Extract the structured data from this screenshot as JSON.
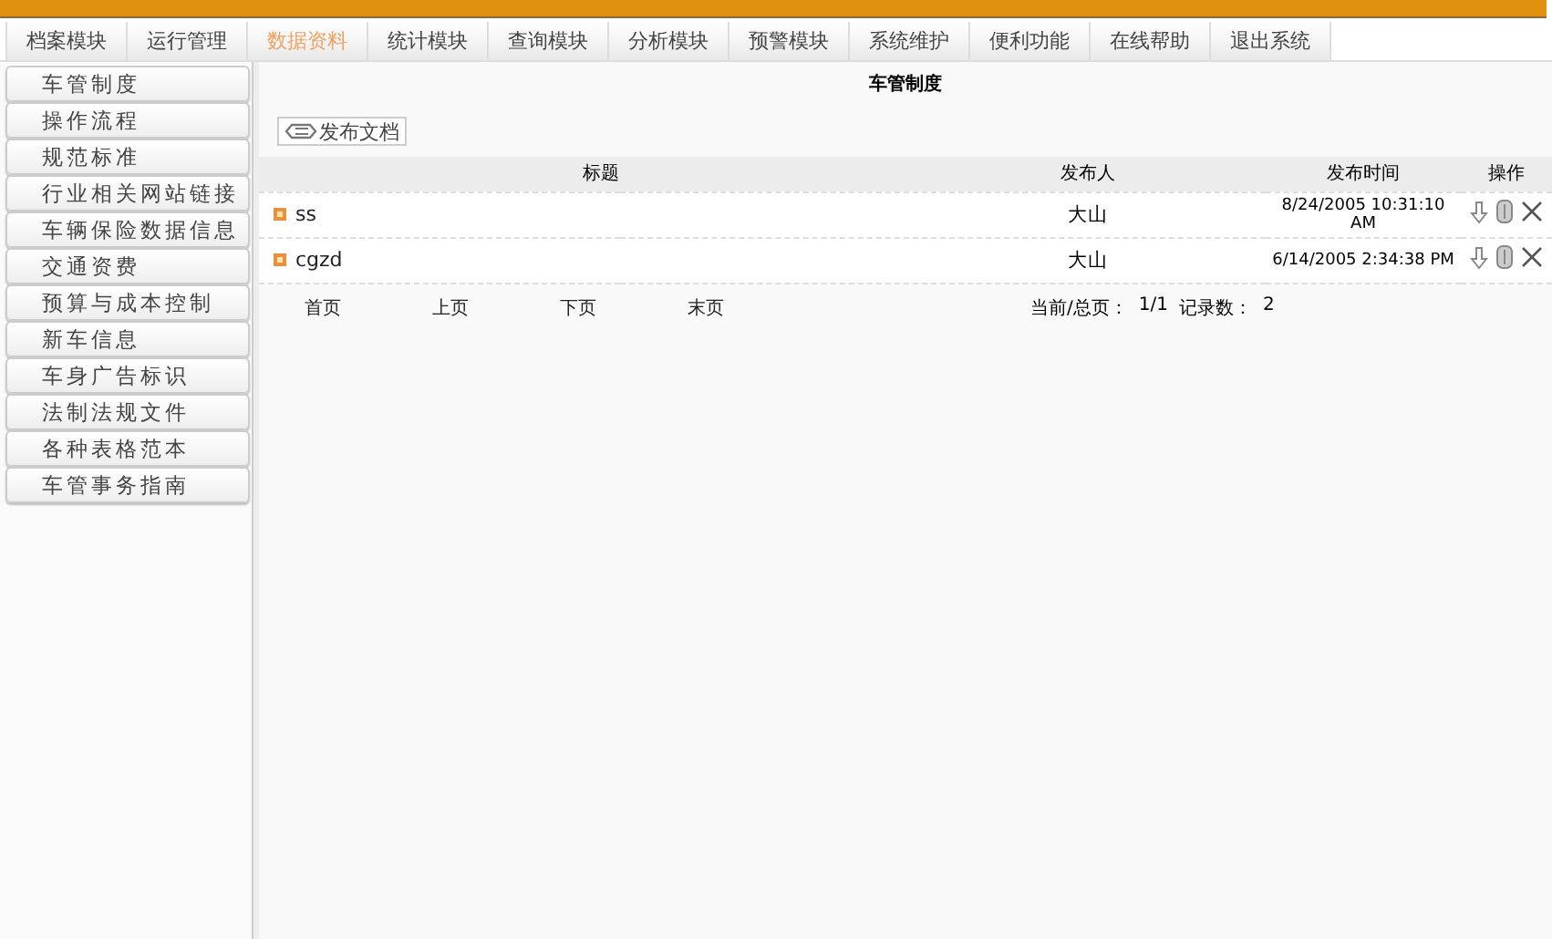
{
  "tabs": [
    {
      "label": "档案模块",
      "selected": false
    },
    {
      "label": "运行管理",
      "selected": false
    },
    {
      "label": "数据资料",
      "selected": true
    },
    {
      "label": "统计模块",
      "selected": false
    },
    {
      "label": "查询模块",
      "selected": false
    },
    {
      "label": "分析模块",
      "selected": false
    },
    {
      "label": "预警模块",
      "selected": false
    },
    {
      "label": "系统维护",
      "selected": false
    },
    {
      "label": "便利功能",
      "selected": false
    },
    {
      "label": "在线帮助",
      "selected": false
    },
    {
      "label": "退出系统",
      "selected": false
    }
  ],
  "sidebar": {
    "items": [
      "车管制度",
      "操作流程",
      "规范标准",
      "行业相关网站链接",
      "车辆保险数据信息",
      "交通资费",
      "预算与成本控制",
      "新车信息",
      "车身广告标识",
      "法制法规文件",
      "各种表格范本",
      "车管事务指南"
    ]
  },
  "content": {
    "title": "车管制度",
    "publish_button": "发布文档",
    "table": {
      "columns": [
        "标题",
        "发布人",
        "发布时间",
        "操作"
      ],
      "rows": [
        {
          "title": "ss",
          "publisher": "大山",
          "time": "8/24/2005 10:31:10 AM"
        },
        {
          "title": "cgzd",
          "publisher": "大山",
          "time": "6/14/2005 2:34:38 PM"
        }
      ]
    },
    "pager": {
      "links": [
        "首页",
        "上页",
        "下页",
        "末页"
      ],
      "page_label": "当前/总页：",
      "page_value": "1/1",
      "count_label": "记录数：",
      "count_value": "2"
    }
  }
}
